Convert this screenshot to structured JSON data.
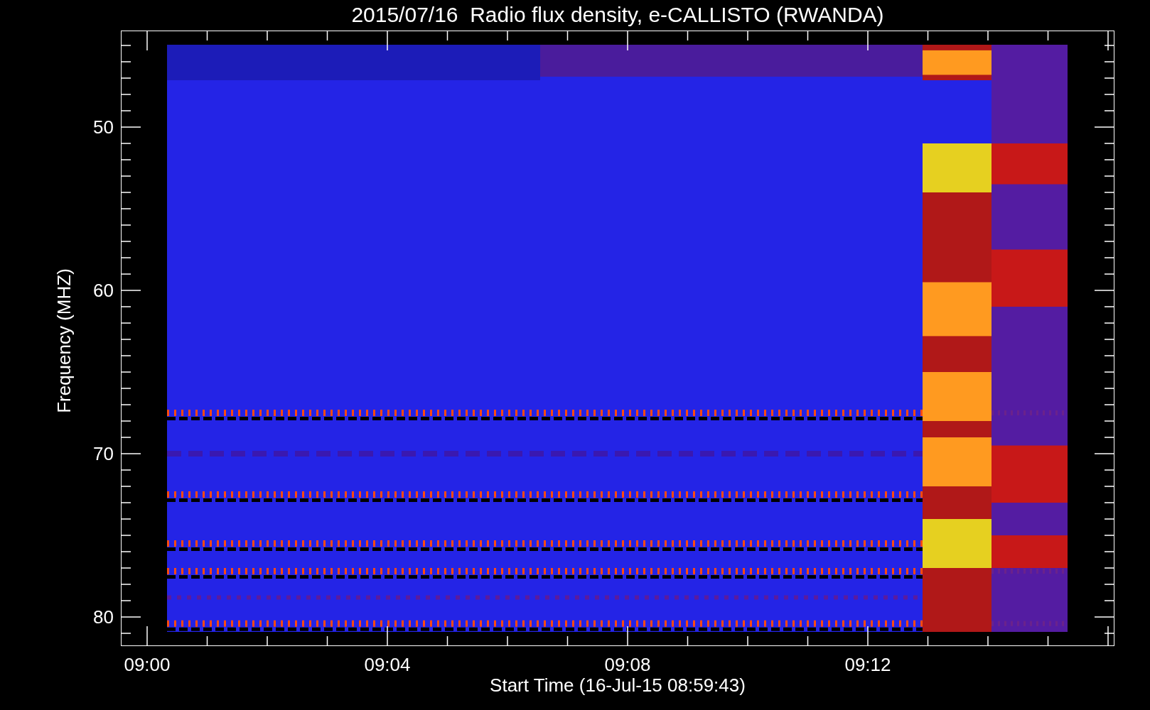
{
  "title": "2015/07/16  Radio flux density, e-CALLISTO (RWANDA)",
  "plot": {
    "ylabel": "Frequency (MHZ)",
    "xlabel": "Start Time (16-Jul-15 08:59:43)",
    "yticks": [
      "50",
      "60",
      "70",
      "80"
    ],
    "xticks": [
      "09:00",
      "09:04",
      "09:08",
      "09:12"
    ]
  }
}
